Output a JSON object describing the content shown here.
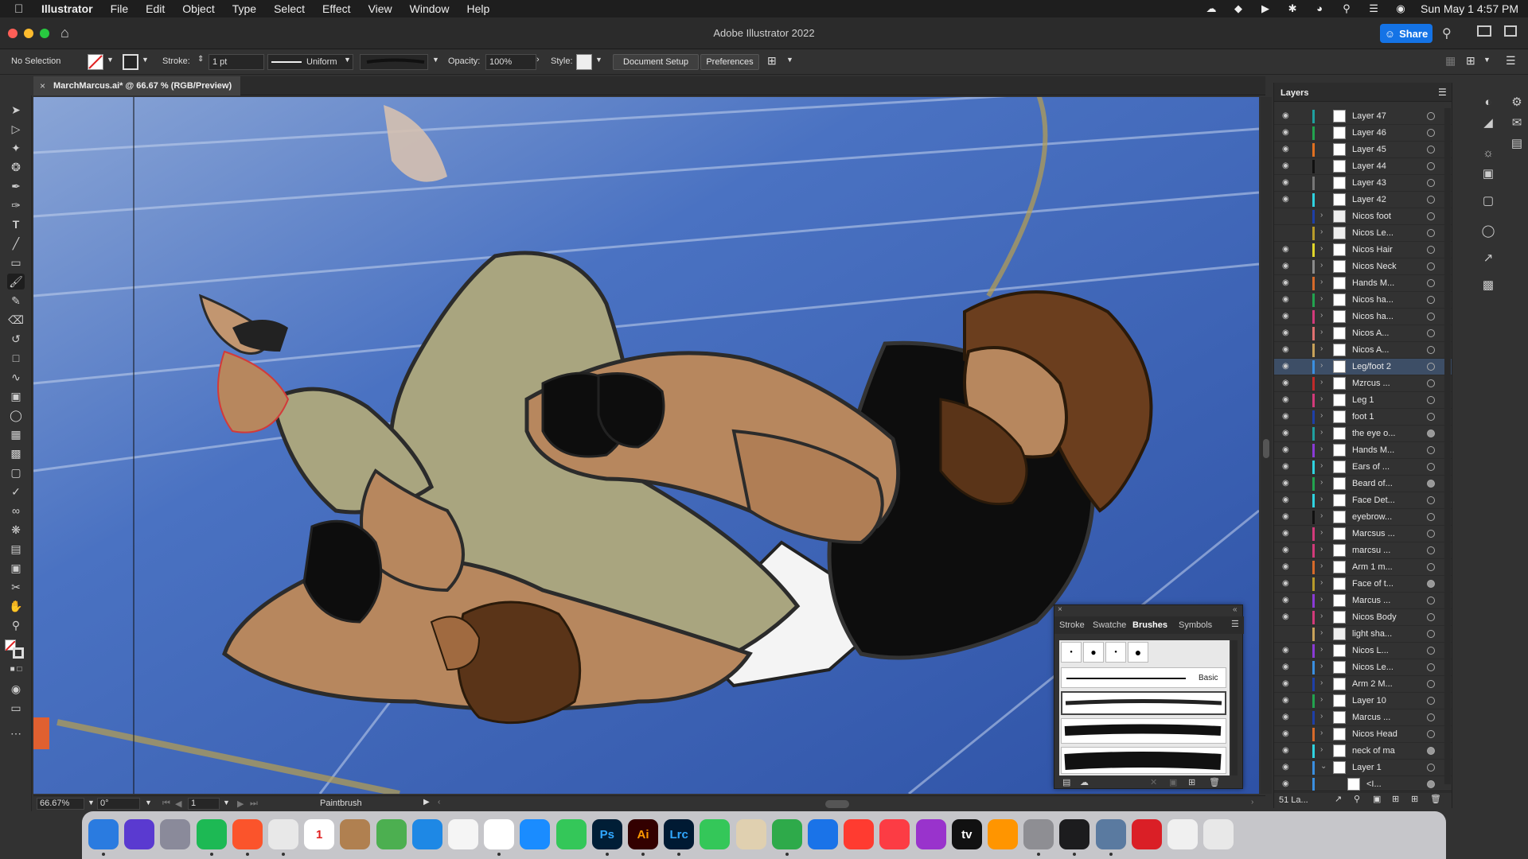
{
  "menubar": {
    "app_name": "Illustrator",
    "items": [
      "File",
      "Edit",
      "Object",
      "Type",
      "Select",
      "Effect",
      "View",
      "Window",
      "Help"
    ],
    "clock": "Sun May 1  4:57 PM"
  },
  "window": {
    "title": "Adobe Illustrator 2022",
    "share_label": "Share"
  },
  "controlbar": {
    "selection": "No Selection",
    "stroke_label": "Stroke:",
    "stroke_value": "1 pt",
    "profile_label": "Uniform",
    "opacity_label": "Opacity:",
    "opacity_value": "100%",
    "style_label": "Style:",
    "doc_setup": "Document Setup",
    "preferences": "Preferences"
  },
  "document": {
    "tab_title": "MarchMarcus.ai* @ 66.67 % (RGB/Preview)"
  },
  "statusbar": {
    "zoom": "66.67%",
    "rotation": "0°",
    "artboard": "1",
    "tool": "Paintbrush"
  },
  "layers_panel": {
    "title": "Layers",
    "count": "51 La...",
    "layers": [
      {
        "name": "Layer 47",
        "color": "#1f9f9f",
        "visible": true,
        "expand": false,
        "target_filled": false
      },
      {
        "name": "Layer 46",
        "color": "#22a34f",
        "visible": true,
        "expand": false,
        "target_filled": false
      },
      {
        "name": "Layer 45",
        "color": "#e07020",
        "visible": true,
        "expand": false,
        "target_filled": false
      },
      {
        "name": "Layer 44",
        "color": "#111111",
        "visible": true,
        "expand": false,
        "target_filled": false
      },
      {
        "name": "Layer 43",
        "color": "#777777",
        "visible": true,
        "expand": false,
        "target_filled": false
      },
      {
        "name": "Layer 42",
        "color": "#2fd3e0",
        "visible": true,
        "expand": false,
        "target_filled": false
      },
      {
        "name": "Nicos foot",
        "color": "#1e3fa8",
        "visible": false,
        "expand": true,
        "target_filled": false
      },
      {
        "name": "Nicos Le...",
        "color": "#b79b2a",
        "visible": false,
        "expand": true,
        "target_filled": false
      },
      {
        "name": "Nicos Hair",
        "color": "#e0d62a",
        "visible": true,
        "expand": true,
        "target_filled": false
      },
      {
        "name": "Nicos Neck",
        "color": "#8a8a8a",
        "visible": true,
        "expand": true,
        "target_filled": false
      },
      {
        "name": "Hands M...",
        "color": "#d66a2a",
        "visible": true,
        "expand": true,
        "target_filled": false
      },
      {
        "name": "Nicos ha...",
        "color": "#22a34f",
        "visible": true,
        "expand": true,
        "target_filled": false
      },
      {
        "name": "Nicos ha...",
        "color": "#d23a7a",
        "visible": true,
        "expand": true,
        "target_filled": false
      },
      {
        "name": "Nicos A...",
        "color": "#e07070",
        "visible": true,
        "expand": true,
        "target_filled": false
      },
      {
        "name": "Nicos A...",
        "color": "#c8a25a",
        "visible": true,
        "expand": true,
        "target_filled": false
      },
      {
        "name": "Leg/foot 2",
        "color": "#3a8fe0",
        "visible": true,
        "expand": true,
        "target_filled": false,
        "selected": true
      },
      {
        "name": "Mzrcus ...",
        "color": "#c02a2a",
        "visible": true,
        "expand": true,
        "target_filled": false
      },
      {
        "name": "Leg 1",
        "color": "#d23a7a",
        "visible": true,
        "expand": true,
        "target_filled": false
      },
      {
        "name": "foot 1",
        "color": "#1e3fa8",
        "visible": true,
        "expand": true,
        "target_filled": false
      },
      {
        "name": "the eye o...",
        "color": "#1f9f9f",
        "visible": true,
        "expand": true,
        "target_filled": true
      },
      {
        "name": "Hands M...",
        "color": "#8a3ad6",
        "visible": true,
        "expand": true,
        "target_filled": false
      },
      {
        "name": "Ears of ...",
        "color": "#2fd3e0",
        "visible": true,
        "expand": true,
        "target_filled": false
      },
      {
        "name": "Beard of...",
        "color": "#22a34f",
        "visible": true,
        "expand": true,
        "target_filled": true
      },
      {
        "name": "Face Det...",
        "color": "#2fd3e0",
        "visible": true,
        "expand": true,
        "target_filled": false
      },
      {
        "name": "eyebrow...",
        "color": "#111111",
        "visible": true,
        "expand": true,
        "target_filled": false
      },
      {
        "name": "Marcsus ...",
        "color": "#d23a7a",
        "visible": true,
        "expand": true,
        "target_filled": false
      },
      {
        "name": "marcsu ...",
        "color": "#d23a7a",
        "visible": true,
        "expand": true,
        "target_filled": false
      },
      {
        "name": "Arm 1 m...",
        "color": "#d66a2a",
        "visible": true,
        "expand": true,
        "target_filled": false
      },
      {
        "name": "Face of t...",
        "color": "#b79b2a",
        "visible": true,
        "expand": true,
        "target_filled": true
      },
      {
        "name": "Marcus ...",
        "color": "#8a3ad6",
        "visible": true,
        "expand": true,
        "target_filled": false
      },
      {
        "name": "Nicos Body",
        "color": "#d23a7a",
        "visible": true,
        "expand": true,
        "target_filled": false
      },
      {
        "name": "light sha...",
        "color": "#c8a25a",
        "visible": false,
        "expand": true,
        "target_filled": false
      },
      {
        "name": "Nicos L...",
        "color": "#8a3ad6",
        "visible": true,
        "expand": true,
        "target_filled": false
      },
      {
        "name": "Nicos Le...",
        "color": "#3a8fe0",
        "visible": true,
        "expand": true,
        "target_filled": false
      },
      {
        "name": "Arm 2 M...",
        "color": "#1e3fa8",
        "visible": true,
        "expand": true,
        "target_filled": false
      },
      {
        "name": "Layer 10",
        "color": "#22a34f",
        "visible": true,
        "expand": true,
        "target_filled": false
      },
      {
        "name": "Marcus ...",
        "color": "#1e3fa8",
        "visible": true,
        "expand": true,
        "target_filled": false
      },
      {
        "name": "Nicos Head",
        "color": "#d66a2a",
        "visible": true,
        "expand": true,
        "target_filled": false
      },
      {
        "name": "neck of ma",
        "color": "#2fd3e0",
        "visible": true,
        "expand": true,
        "target_filled": true
      },
      {
        "name": "Layer 1",
        "color": "#3a8fe0",
        "visible": true,
        "expand": true,
        "target_filled": false,
        "expanded": true
      },
      {
        "name": "<I...",
        "color": "#3a8fe0",
        "visible": true,
        "expand": false,
        "target_filled": true,
        "child": true
      }
    ]
  },
  "brushes_panel": {
    "tabs": [
      "Stroke",
      "Swatche",
      "Brushes",
      "Symbols"
    ],
    "active_tab": "Brushes",
    "basic_label": "Basic"
  },
  "dock": {
    "apps": [
      {
        "name": "Finder",
        "color": "#2a7be0",
        "label": ""
      },
      {
        "name": "Siri",
        "color": "#5a3ad0",
        "label": ""
      },
      {
        "name": "Launchpad",
        "color": "#8a8a9a",
        "label": ""
      },
      {
        "name": "Spotify",
        "color": "#1db954",
        "label": ""
      },
      {
        "name": "Brave",
        "color": "#fb542b",
        "label": ""
      },
      {
        "name": "Chrome",
        "color": "#e8e8e8",
        "label": ""
      },
      {
        "name": "Calendar",
        "color": "#ffffff",
        "label": "1"
      },
      {
        "name": "Contacts",
        "color": "#b08050",
        "label": ""
      },
      {
        "name": "Maps",
        "color": "#4caf50",
        "label": ""
      },
      {
        "name": "Safari",
        "color": "#1e88e5",
        "label": ""
      },
      {
        "name": "Photos",
        "color": "#f5f5f5",
        "label": ""
      },
      {
        "name": "Reminders",
        "color": "#ffffff",
        "label": ""
      },
      {
        "name": "App Store",
        "color": "#1a8cff",
        "label": ""
      },
      {
        "name": "Messages",
        "color": "#34c759",
        "label": ""
      },
      {
        "name": "Photoshop",
        "color": "#001e36",
        "label": "Ps"
      },
      {
        "name": "Illustrator",
        "color": "#330000",
        "label": "Ai"
      },
      {
        "name": "Lightroom Classic",
        "color": "#001a33",
        "label": "Lrc"
      },
      {
        "name": "FaceTime",
        "color": "#34c759",
        "label": ""
      },
      {
        "name": "Preview",
        "color": "#e0d0b0",
        "label": ""
      },
      {
        "name": "Numbers",
        "color": "#2eaa4a",
        "label": ""
      },
      {
        "name": "Keynote",
        "color": "#1a73e8",
        "label": ""
      },
      {
        "name": "News",
        "color": "#ff3b30",
        "label": ""
      },
      {
        "name": "Music",
        "color": "#fc3c44",
        "label": ""
      },
      {
        "name": "Podcasts",
        "color": "#9933cc",
        "label": ""
      },
      {
        "name": "TV",
        "color": "#111111",
        "label": "tv"
      },
      {
        "name": "Books",
        "color": "#ff9500",
        "label": ""
      },
      {
        "name": "System Preferences",
        "color": "#8e8e93",
        "label": ""
      },
      {
        "name": "Activity Monitor",
        "color": "#1c1c1e",
        "label": ""
      },
      {
        "name": "Screen",
        "color": "#5a7aa0",
        "label": ""
      },
      {
        "name": "Creative Cloud",
        "color": "#da1f26",
        "label": ""
      },
      {
        "name": "Document",
        "color": "#f0f0f0",
        "label": ""
      },
      {
        "name": "Trash",
        "color": "#e8e8e8",
        "label": ""
      }
    ]
  },
  "colors": {
    "accent": "#1473e6",
    "panel_bg": "#323232",
    "mat_blue": "#3b62b6",
    "skin": "#b7875e",
    "shirt": "#a9a57f",
    "gloves": "#0d0d0d"
  }
}
